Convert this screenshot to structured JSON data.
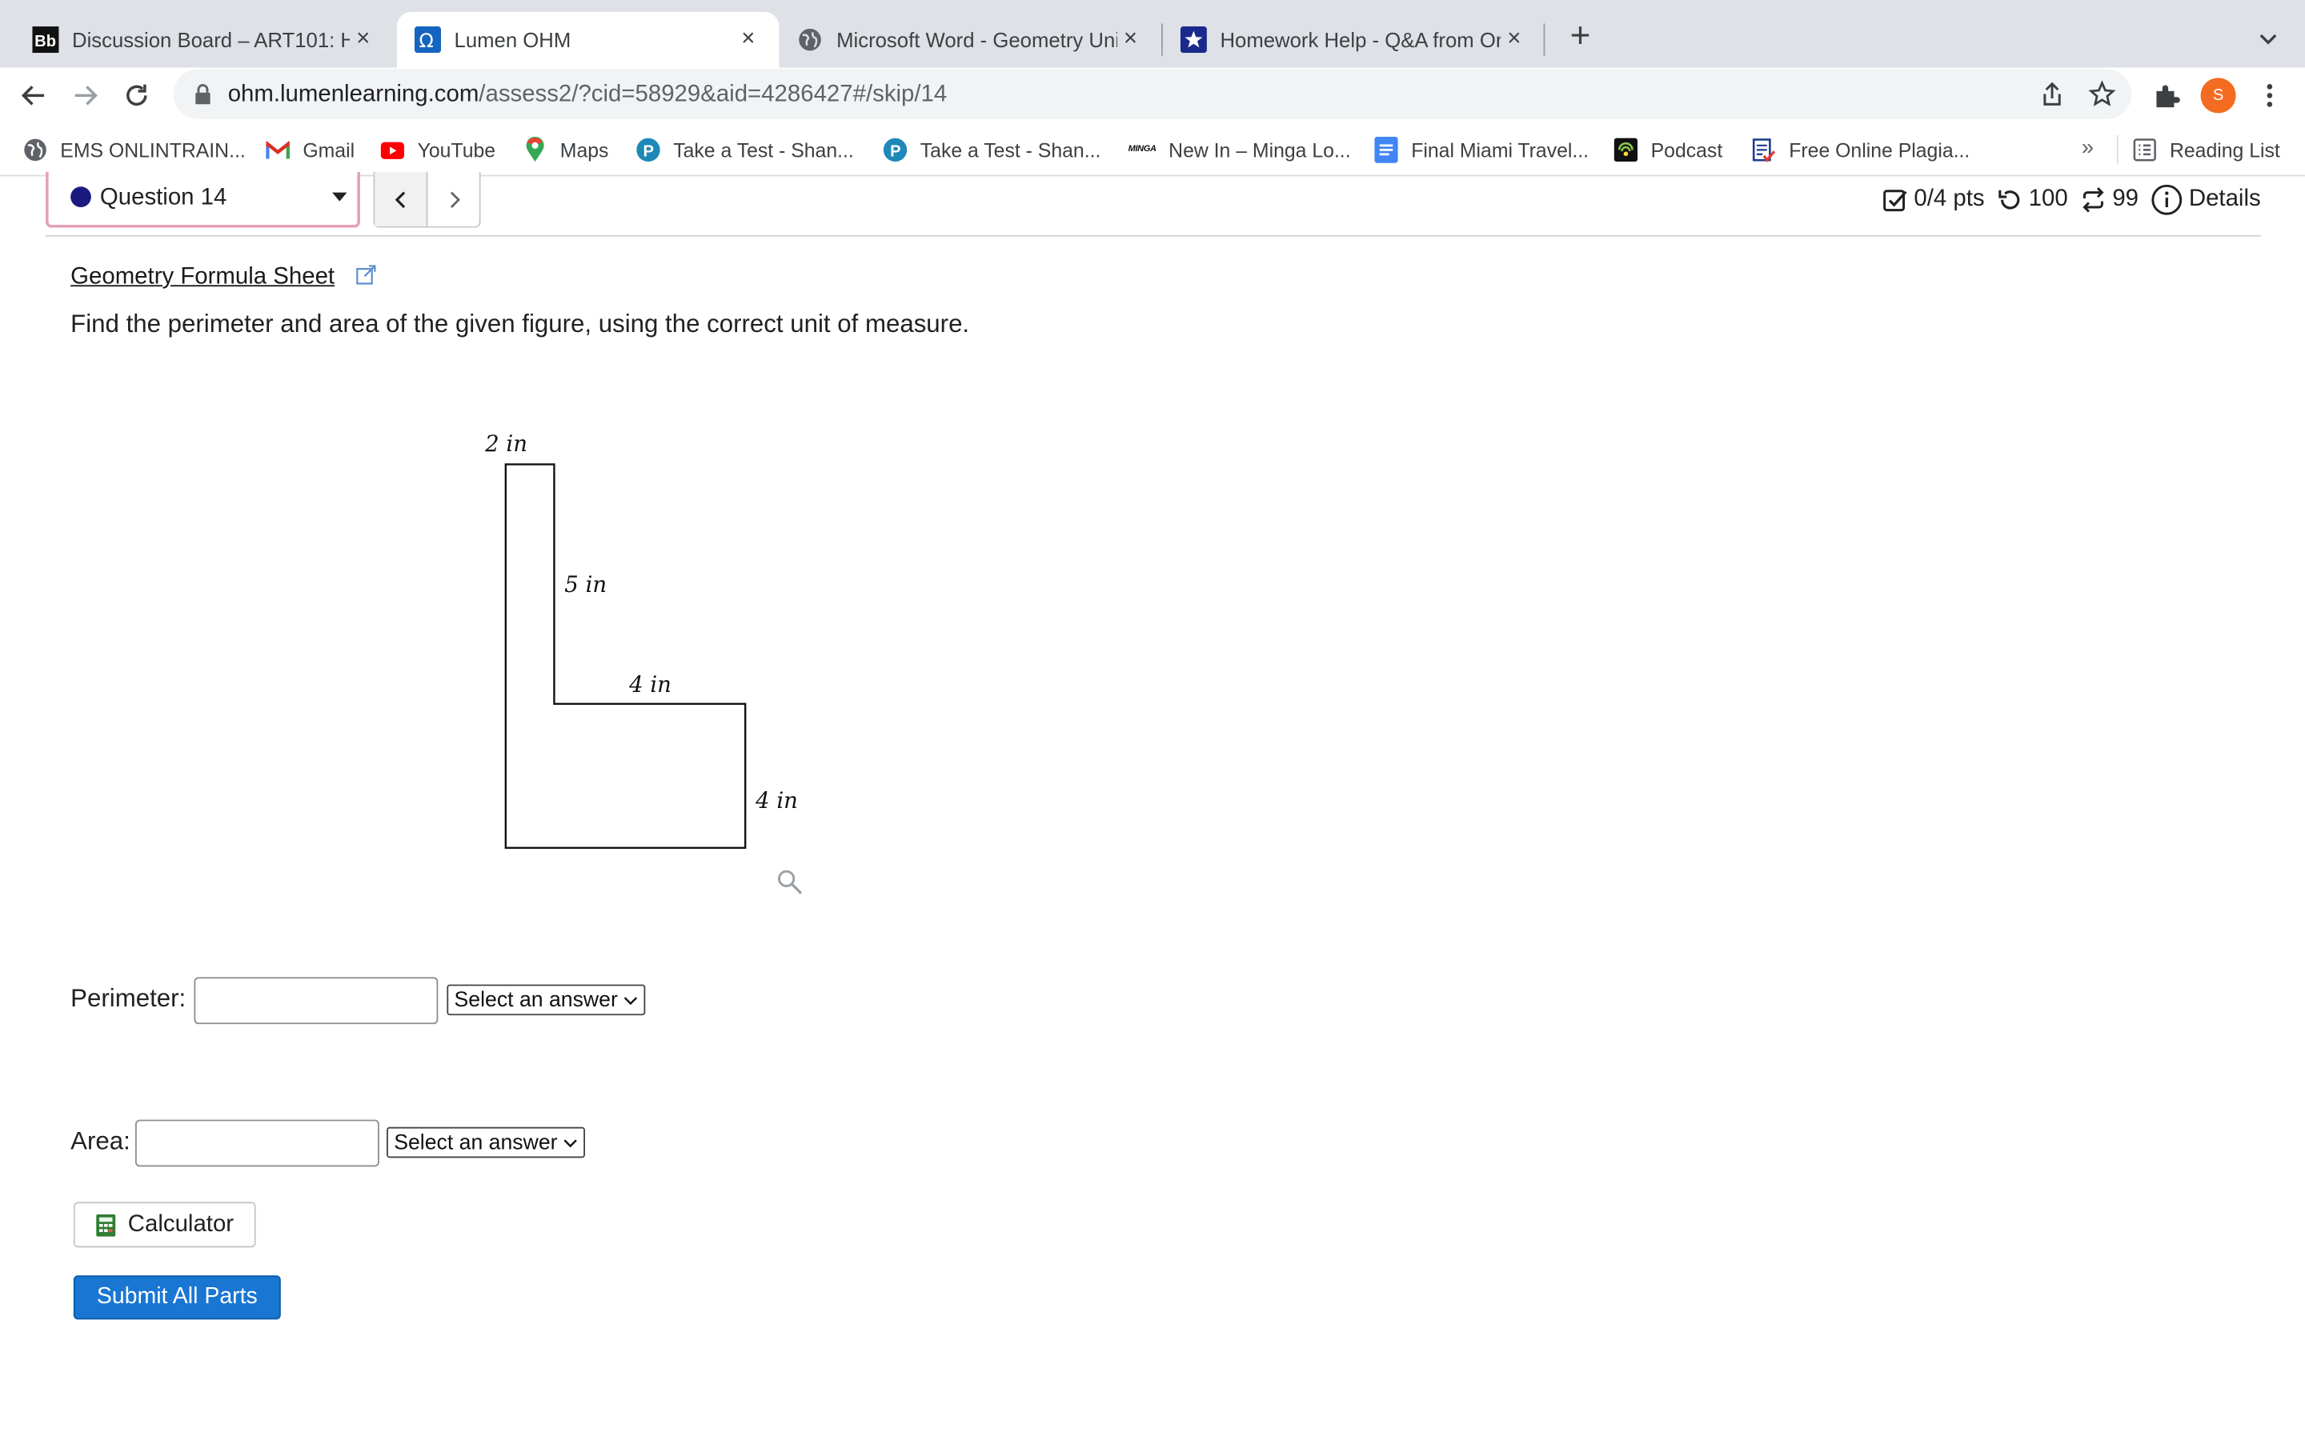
{
  "browser": {
    "tabs": [
      {
        "favicon": "blackboard-icon",
        "title": "Discussion Board – ART101: HIS",
        "close": "×"
      },
      {
        "favicon": "lumen-omega-icon",
        "title": "Lumen OHM",
        "close": "×",
        "active": true
      },
      {
        "favicon": "globe-icon",
        "title": "Microsoft Word - Geometry Uni",
        "close": "×"
      },
      {
        "favicon": "star-shield-icon",
        "title": "Homework Help - Q&A from On",
        "close": "×"
      }
    ],
    "new_tab": "+",
    "url_host": "ohm.lumenlearning.com",
    "url_path": "/assess2/?cid=58929&aid=4286427#/skip/14",
    "profile_initial": "S",
    "profile_color": "#f36c21"
  },
  "bookmarks": {
    "items": [
      {
        "icon": "globe-icon",
        "label": "EMS ONLINTRAIN..."
      },
      {
        "icon": "gmail-icon",
        "label": "Gmail"
      },
      {
        "icon": "youtube-icon",
        "label": "YouTube"
      },
      {
        "icon": "maps-pin-icon",
        "label": "Maps"
      },
      {
        "icon": "p-circle-icon",
        "label": "Take a Test - Shan..."
      },
      {
        "icon": "p-circle-icon",
        "label": "Take a Test - Shan..."
      },
      {
        "icon": "minga-icon",
        "label": "New In – Minga Lo...",
        "icon_text": "MINGA"
      },
      {
        "icon": "docs-icon",
        "label": "Final Miami Travel..."
      },
      {
        "icon": "podcast-icon",
        "label": "Podcast"
      },
      {
        "icon": "plagiarism-icon",
        "label": "Free Online Plagia..."
      }
    ],
    "overflow": "»",
    "reading_list": "Reading List"
  },
  "assessment": {
    "question_selector": "Question 14",
    "status_dot_color": "#1a1a80",
    "points": "0/4 pts",
    "attempts_remaining": "100",
    "versions_remaining": "99",
    "details_label": "Details",
    "formula_link": "Geometry Formula Sheet",
    "question_text": "Find the perimeter and area of the given figure, using the correct unit of measure.",
    "figure_labels": {
      "top": "2 in",
      "inner_vertical": "5 in",
      "inner_horizontal": "4 in",
      "right": "4 in"
    },
    "perimeter_label": "Perimeter:",
    "perimeter_value": "",
    "perimeter_unit_select": "Select an answer",
    "area_label": "Area:",
    "area_value": "",
    "area_unit_select": "Select an answer",
    "calculator_label": "Calculator",
    "submit_label": "Submit All Parts",
    "submit_color": "#1976d2"
  }
}
